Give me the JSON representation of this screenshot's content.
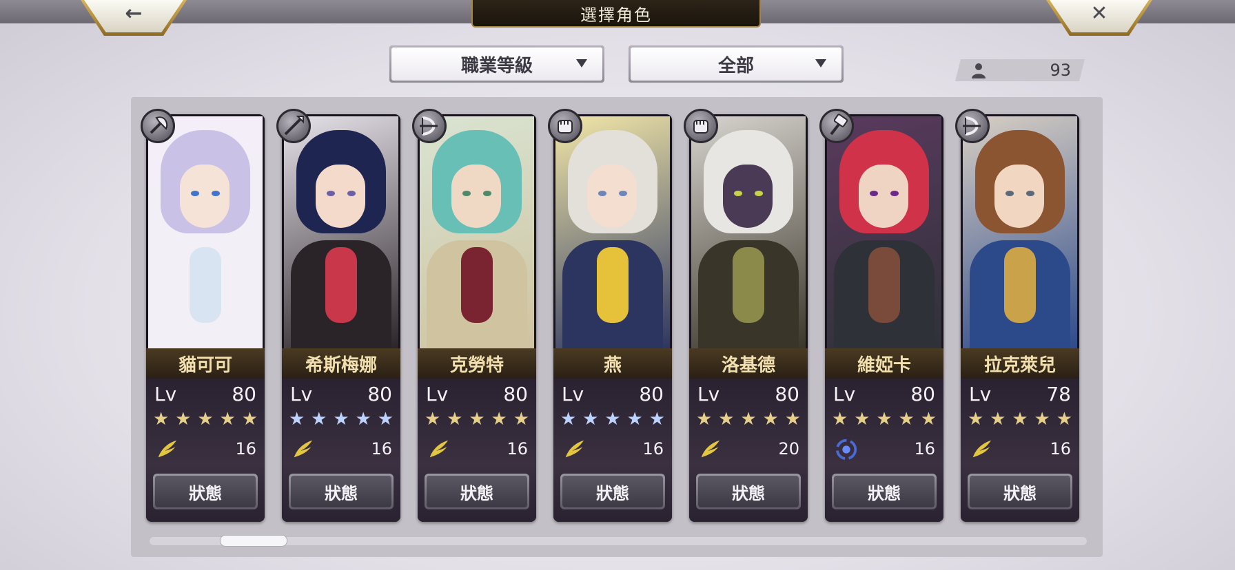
{
  "header": {
    "title": "選擇角色",
    "back_label": "←",
    "close_label": "✕"
  },
  "filters": {
    "sort": "職業等級",
    "category": "全部"
  },
  "roster_count": "93",
  "status_label": "狀態",
  "lv_label": "Lv",
  "characters": [
    {
      "name": "貓可可",
      "level": "80",
      "stars": "★★★★★",
      "star_color": "gold",
      "power": "16",
      "element": "wing",
      "class": "axe",
      "palette": {
        "bg": "#f3eef7",
        "hair": "#c9c1e6",
        "skin": "#f6e3d8",
        "eye": "#3f74c8",
        "body": "#f2f0f6",
        "accent": "#d9e4f2"
      }
    },
    {
      "name": "希斯梅娜",
      "level": "80",
      "stars": "★★★★★",
      "star_color": "blue",
      "power": "16",
      "element": "wing",
      "class": "spear",
      "palette": {
        "bg": "#e7e3ea",
        "hair": "#1d2550",
        "skin": "#f4dacb",
        "eye": "#6b5fa8",
        "body": "#2a2428",
        "accent": "#c9374a"
      }
    },
    {
      "name": "克勞特",
      "level": "80",
      "stars": "★★★★★",
      "star_color": "gold",
      "power": "16",
      "element": "wing",
      "class": "bow",
      "palette": {
        "bg": "#d9e4d2",
        "hair": "#67bfb6",
        "skin": "#f0d9c4",
        "eye": "#4d8a6a",
        "body": "#cfc3a0",
        "accent": "#7a2431"
      }
    },
    {
      "name": "燕",
      "level": "80",
      "stars": "★★★★★",
      "star_color": "blue",
      "power": "16",
      "element": "wing",
      "class": "fist",
      "palette": {
        "bg": "#f2e7a8",
        "hair": "#e3e0da",
        "skin": "#f4ded0",
        "eye": "#6b86b8",
        "body": "#2c3560",
        "accent": "#e6c23a"
      }
    },
    {
      "name": "洛基德",
      "level": "80",
      "stars": "★★★★★",
      "star_color": "gold",
      "power": "20",
      "element": "wing",
      "class": "fist",
      "palette": {
        "bg": "#d7d4cf",
        "hair": "#e8e6e2",
        "skin": "#4b3a56",
        "eye": "#c8d24a",
        "body": "#3a3529",
        "accent": "#8c8a4a"
      }
    },
    {
      "name": "維婭卡",
      "level": "80",
      "stars": "★★★★★",
      "star_color": "gold",
      "power": "16",
      "element": "vortex",
      "class": "hammer",
      "palette": {
        "bg": "#5a3a5e",
        "hair": "#d0324a",
        "skin": "#efd4c4",
        "eye": "#6b2a8a",
        "body": "#2e3138",
        "accent": "#7a4a3a"
      }
    },
    {
      "name": "拉克萊兒",
      "level": "78",
      "stars": "★★★★★",
      "star_color": "gold",
      "power": "16",
      "element": "wing",
      "class": "bow",
      "palette": {
        "bg": "#d8cfc4",
        "hair": "#8a5530",
        "skin": "#f1d6c2",
        "eye": "#5a6a7a",
        "body": "#2c4a8a",
        "accent": "#c9a24a"
      }
    }
  ]
}
